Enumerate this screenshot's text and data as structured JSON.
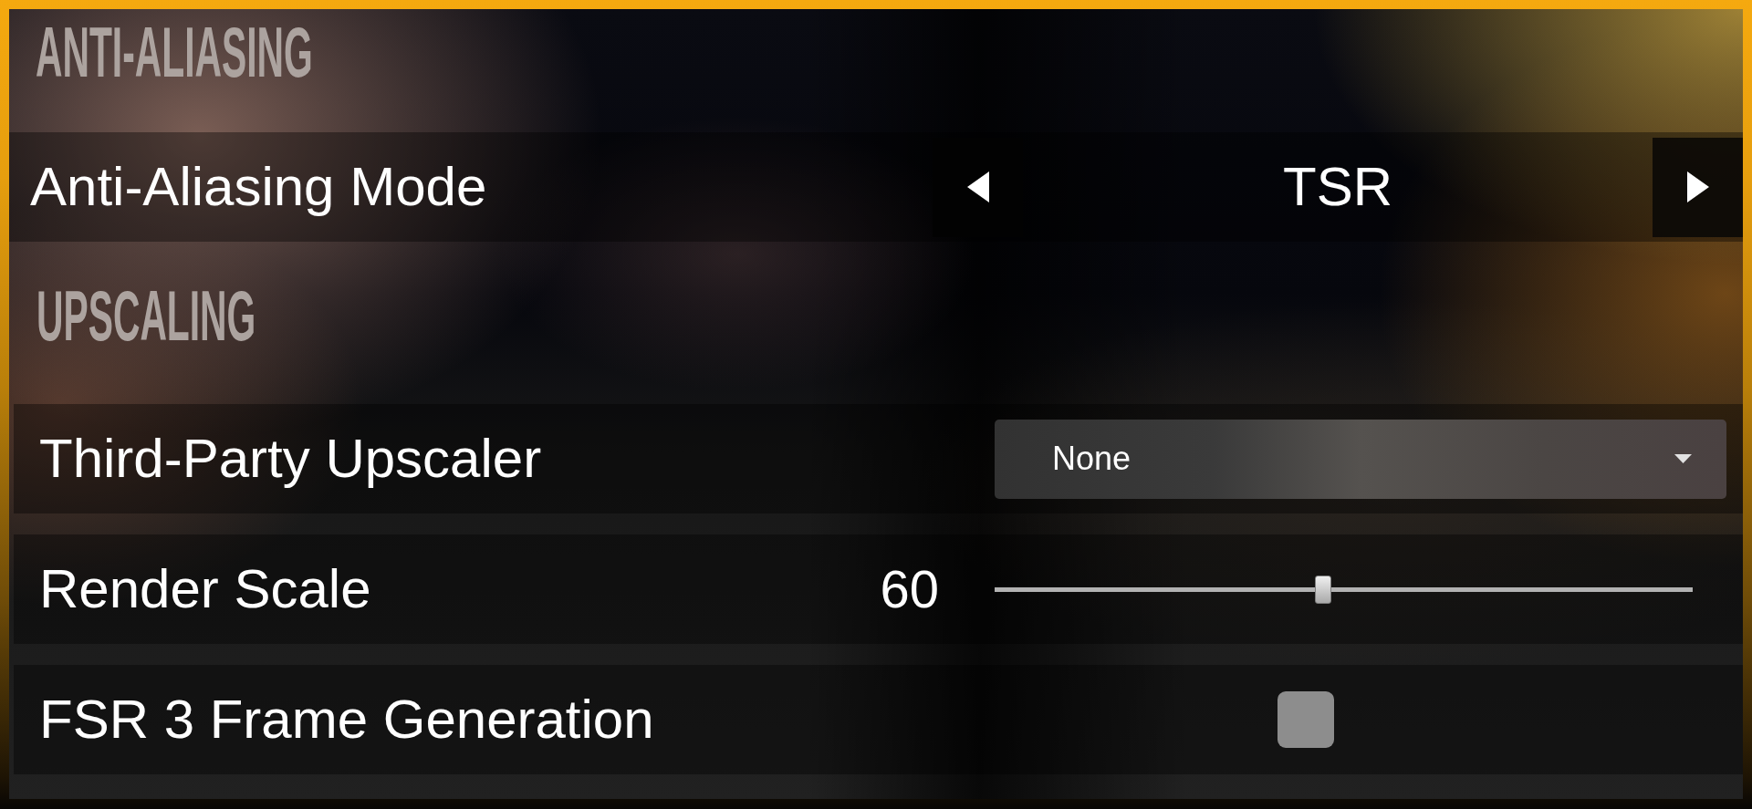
{
  "sections": [
    {
      "heading": "ANTI-ALIASING",
      "settings": [
        {
          "kind": "selector",
          "label": "Anti-Aliasing Mode",
          "value": "TSR"
        }
      ]
    },
    {
      "heading": "UPSCALING",
      "settings": [
        {
          "kind": "dropdown",
          "label": "Third-Party Upscaler",
          "value": "None"
        },
        {
          "kind": "slider",
          "label": "Render Scale",
          "reading": "60",
          "level": 0.47
        },
        {
          "kind": "checkbox",
          "label": "FSR 3 Frame Generation",
          "checked": false
        }
      ]
    }
  ]
}
